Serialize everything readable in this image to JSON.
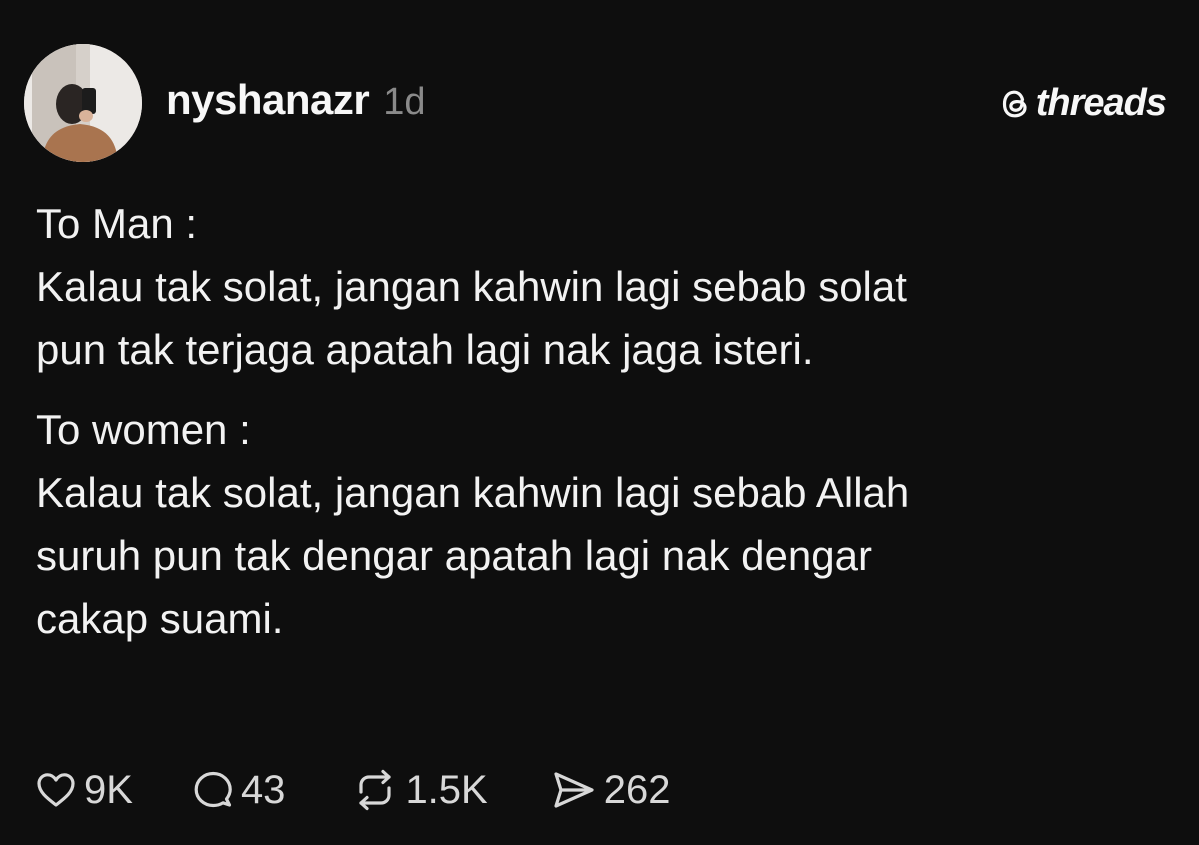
{
  "post": {
    "username": "nyshanazr",
    "time": "1d",
    "brand": "threads",
    "paragraphs": [
      "To Man :\nKalau tak solat, jangan kahwin lagi sebab solat\npun tak terjaga apatah lagi nak jaga isteri.",
      "To women :\nKalau tak solat, jangan kahwin lagi sebab Allah\nsuruh pun tak dengar apatah lagi nak dengar\ncakap suami."
    ],
    "actions": {
      "likes": "9K",
      "replies": "43",
      "reposts": "1.5K",
      "shares": "262"
    },
    "icons": {
      "avatar": "profile-photo",
      "brand": "threads-logo-icon",
      "like": "heart-icon",
      "reply": "comment-bubble-icon",
      "repost": "repost-icon",
      "share": "send-icon"
    },
    "colors": {
      "background": "#0e0e0e",
      "text": "#f2f2f2",
      "muted": "#8a8a8a"
    }
  }
}
